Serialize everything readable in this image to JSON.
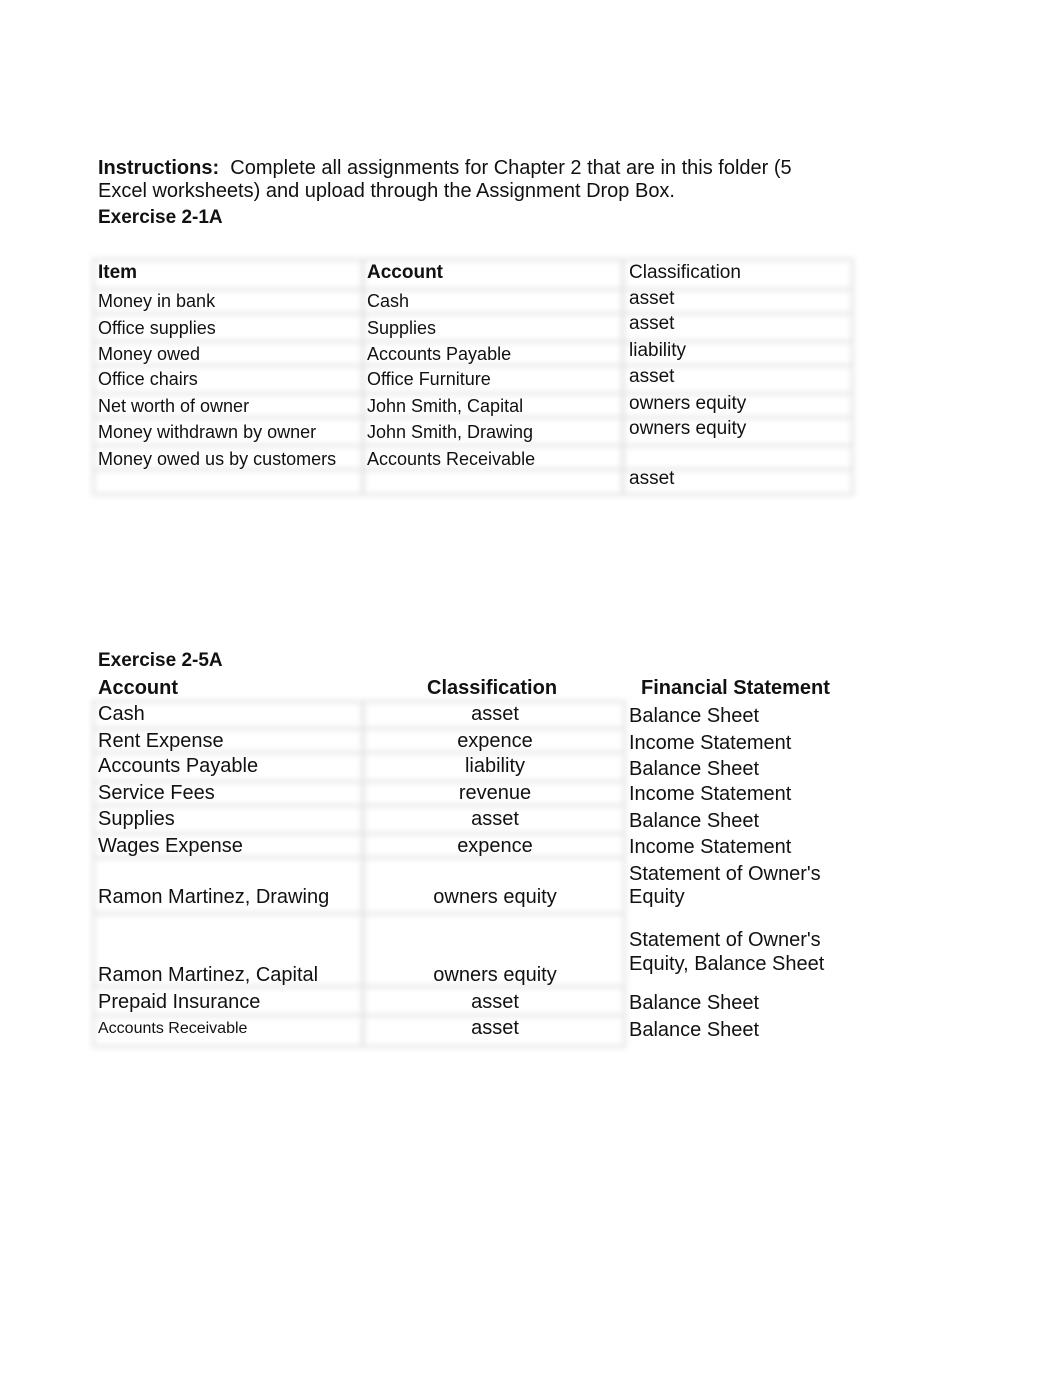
{
  "instructions": {
    "label": "Instructions:",
    "text": "Complete all assignments for Chapter 2 that are in this folder (5 Excel worksheets) and upload through the Assignment Drop Box."
  },
  "exercise1": {
    "title": "Exercise 2-1A",
    "headers": [
      "Item",
      "Account",
      "Classification"
    ],
    "rows": [
      {
        "item": "Money in bank",
        "account": "Cash",
        "classification": "asset"
      },
      {
        "item": "Office supplies",
        "account": "Supplies",
        "classification": "asset"
      },
      {
        "item": "Money owed",
        "account": "Accounts Payable",
        "classification": "liability"
      },
      {
        "item": "Office chairs",
        "account": "Office Furniture",
        "classification": "asset"
      },
      {
        "item": "Net worth of owner",
        "account": "John Smith, Capital",
        "classification": "owners equity"
      },
      {
        "item": "Money withdrawn by owner",
        "account": "John Smith, Drawing",
        "classification": "owners equity"
      },
      {
        "item": "Money owed us by customers",
        "account": "Accounts Receivable",
        "classification": "asset"
      }
    ]
  },
  "exercise2": {
    "title": "Exercise 2-5A",
    "headers": [
      "Account",
      "Classification",
      "Financial Statement"
    ],
    "rows": [
      {
        "account": "Cash",
        "classification": "asset",
        "statement": "Balance Sheet"
      },
      {
        "account": "Rent Expense",
        "classification": "expence",
        "statement": "Income Statement"
      },
      {
        "account": "Accounts Payable",
        "classification": "liability",
        "statement": "Balance Sheet"
      },
      {
        "account": "Service Fees",
        "classification": "revenue",
        "statement": "Income Statement"
      },
      {
        "account": "Supplies",
        "classification": "asset",
        "statement": "Balance Sheet"
      },
      {
        "account": "Wages Expense",
        "classification": "expence",
        "statement": "Income Statement"
      },
      {
        "account": "Ramon Martinez, Drawing",
        "classification": "owners equity",
        "statement_line1": "Statement of Owner's",
        "statement_line2": "Equity"
      },
      {
        "account": "Ramon Martinez, Capital",
        "classification": "owners equity",
        "statement_line1": "Statement of Owner's",
        "statement_line2": "Equity, Balance Sheet"
      },
      {
        "account": "Prepaid Insurance",
        "classification": "asset",
        "statement": "Balance Sheet"
      },
      {
        "account": "Accounts Receivable",
        "classification": "asset",
        "statement": "Balance Sheet"
      }
    ]
  }
}
